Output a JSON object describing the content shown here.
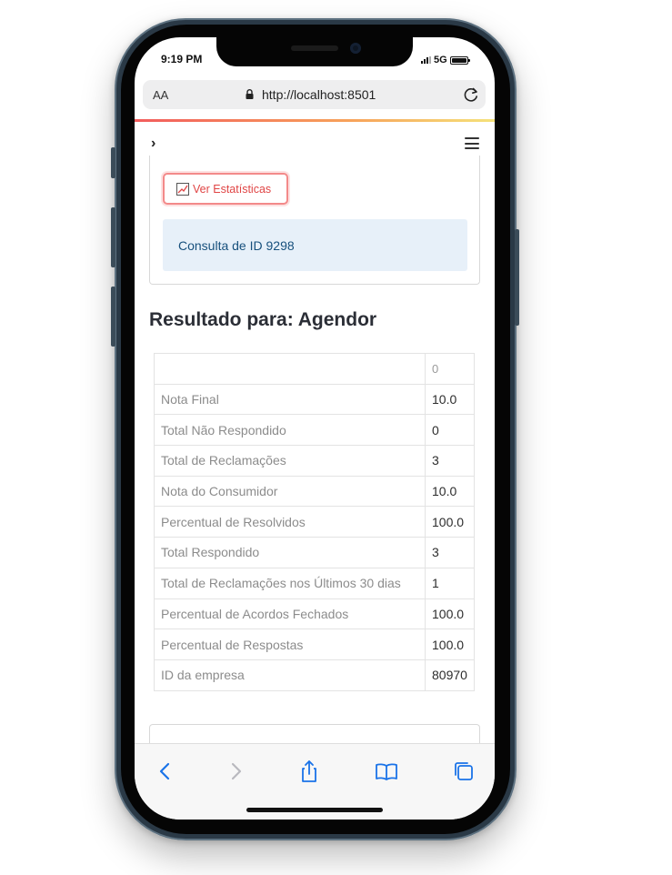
{
  "status_bar": {
    "time": "9:19 PM",
    "network": "5G"
  },
  "browser": {
    "text_size_button": "AA",
    "url": "http://localhost:8501",
    "icons": [
      "lock-icon",
      "reload-icon"
    ]
  },
  "app_header": {
    "sidebar_toggle": "›",
    "menu_icon": "hamburger-menu-icon"
  },
  "stats_button": {
    "label": "Ver Estatísticas",
    "icon": "chart-icon",
    "accent_color": "#e04545"
  },
  "info_box": {
    "text": "Consulta de ID 9298",
    "background_color": "#e7f0f9"
  },
  "result": {
    "title": "Resultado para: Agendor",
    "column_header": "0",
    "rows": [
      {
        "label": "Nota Final",
        "value": "10.0"
      },
      {
        "label": "Total Não Respondido",
        "value": "0"
      },
      {
        "label": "Total de Reclamações",
        "value": "3"
      },
      {
        "label": "Nota do Consumidor",
        "value": "10.0"
      },
      {
        "label": "Percentual de Resolvidos",
        "value": "100.0"
      },
      {
        "label": "Total Respondido",
        "value": "3"
      },
      {
        "label": "Total de Reclamações nos Últimos 30 dias",
        "value": "1"
      },
      {
        "label": "Percentual de Acordos Fechados",
        "value": "100.0"
      },
      {
        "label": "Percentual de Respostas",
        "value": "100.0"
      },
      {
        "label": "ID da empresa",
        "value": "80970"
      }
    ]
  },
  "safari_toolbar": {
    "icons": [
      "back-icon",
      "forward-icon",
      "share-icon",
      "bookmarks-icon",
      "tabs-icon"
    ],
    "accent_color": "#1a73e8"
  }
}
